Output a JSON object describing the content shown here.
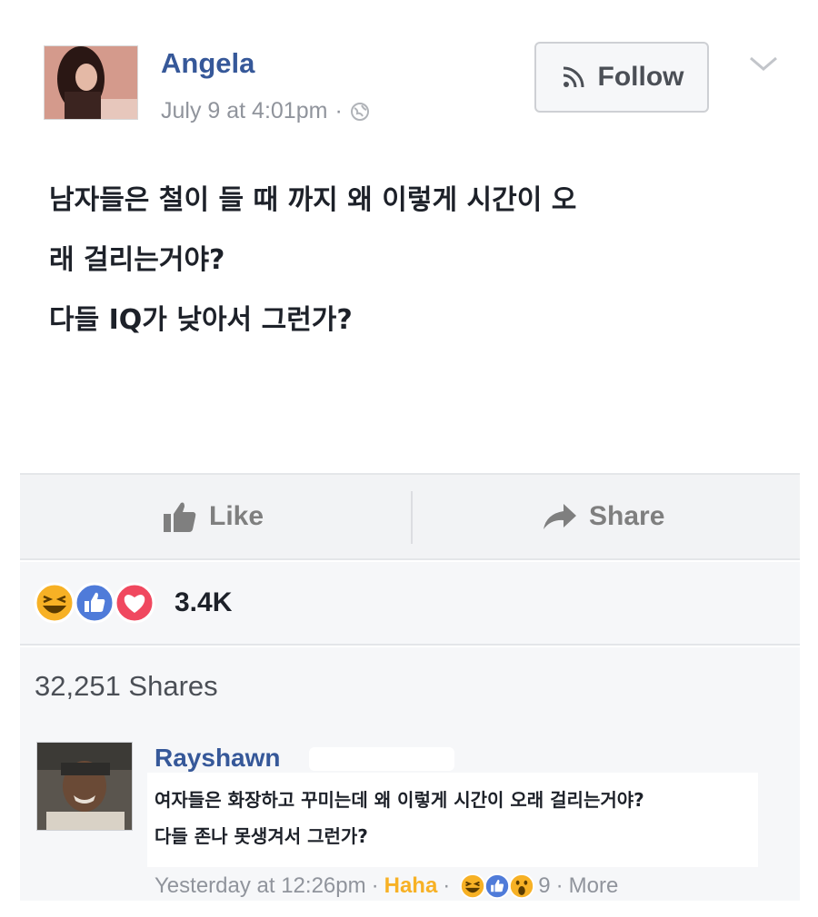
{
  "post": {
    "author": "Angela",
    "timestamp": "July 9 at 4:01pm",
    "meta_separator": "·",
    "follow_label": "Follow",
    "text_lines": [
      "남자들은 철이 들 때 까지 왜 이렇게 시간이 오",
      "래 걸리는거야?",
      "다들 IQ가 낮아서 그런가?"
    ]
  },
  "actions": {
    "like_label": "Like",
    "share_label": "Share"
  },
  "reactions": {
    "count": "3.4K",
    "icons": [
      "haha-icon",
      "like-icon",
      "love-icon"
    ]
  },
  "shares": {
    "label": "32,251 Shares"
  },
  "comment": {
    "author": "Rayshawn",
    "text_lines": [
      "여자들은 화장하고 꾸미는데 왜 이렇게 시간이 오래 걸리는거야?",
      "다들 존나 못생겨서 그런가?"
    ],
    "timestamp": "Yesterday at 12:26pm",
    "separator": "·",
    "reaction_label": "Haha",
    "reaction_count": "9",
    "more_label": "More"
  },
  "colors": {
    "name_blue": "#365899",
    "meta_gray": "#90949c",
    "haha_yellow": "#f7b125",
    "like_blue": "#4f7bd9",
    "love_red": "#f0485f"
  }
}
